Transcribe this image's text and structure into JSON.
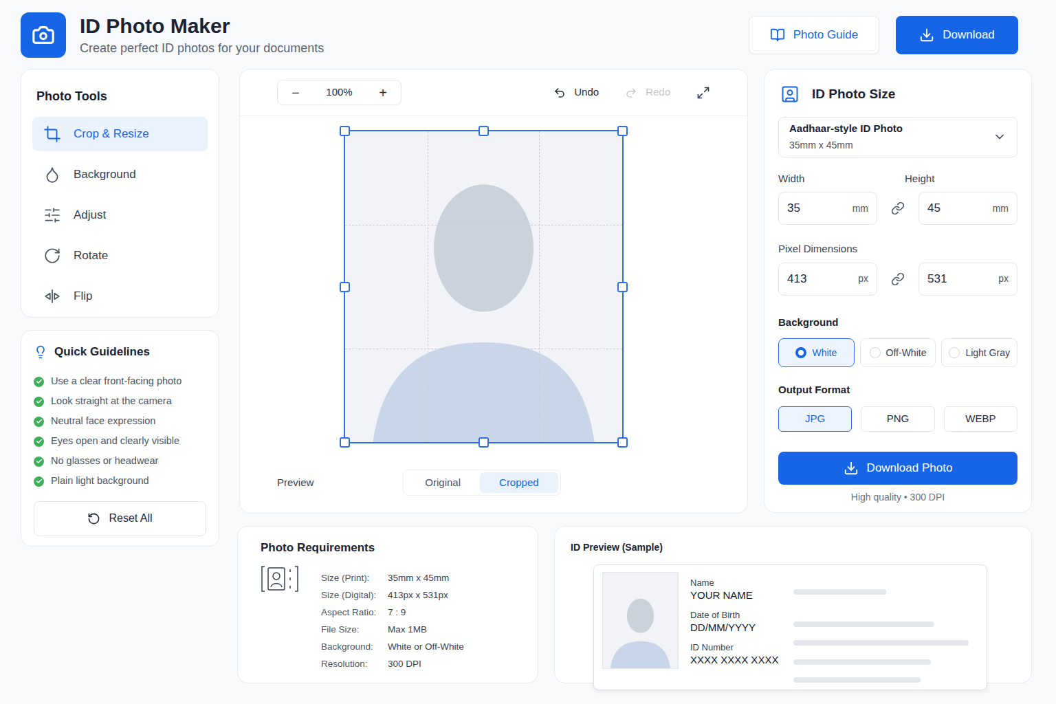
{
  "header": {
    "title": "ID Photo Maker",
    "subtitle": "Create perfect ID photos for your documents",
    "buttons": [
      {
        "label": "Photo Guide",
        "kind": "outline"
      },
      {
        "label": "Download",
        "kind": "primary"
      }
    ]
  },
  "tools": {
    "title": "Photo Tools",
    "items": [
      {
        "label": "Crop & Resize",
        "selected": true
      },
      {
        "label": "Background",
        "selected": false
      },
      {
        "label": "Adjust",
        "selected": false
      },
      {
        "label": "Rotate",
        "selected": false
      },
      {
        "label": "Flip",
        "selected": false
      }
    ]
  },
  "guidelines": {
    "title": "Quick Guidelines",
    "items": [
      {
        "label": "Use a clear front-facing photo",
        "checked": true
      },
      {
        "label": "Look straight at the camera",
        "checked": true
      },
      {
        "label": "Neutral face expression",
        "checked": true
      },
      {
        "label": "Eyes open and clearly visible",
        "checked": true
      },
      {
        "label": "No glasses or headwear",
        "checked": true
      },
      {
        "label": "Plain light background",
        "checked": true
      }
    ],
    "reset": "Reset All"
  },
  "editor": {
    "zoom_out": "−",
    "zoom": "100%",
    "zoom_in": "+",
    "undo": {
      "label": "Undo",
      "disabled": false
    },
    "redo": {
      "label": "Redo",
      "disabled": true
    },
    "preview": {
      "label": "Preview",
      "tabs": [
        {
          "label": "Original",
          "selected": false
        },
        {
          "label": "Cropped",
          "selected": true
        }
      ]
    }
  },
  "size_panel": {
    "title": "ID Photo Size",
    "preset": {
      "name": "Aadhaar-style ID Photo",
      "size": "35mm x 45mm"
    },
    "physical": {
      "width": {
        "label": "Width",
        "value": "35",
        "unit": "mm"
      },
      "height": {
        "label": "Height",
        "value": "45",
        "unit": "mm"
      },
      "linked": true
    },
    "pixels": {
      "label": "Pixel Dimensions",
      "width": {
        "value": "413",
        "unit": "px"
      },
      "height": {
        "value": "531",
        "unit": "px"
      },
      "linked": true
    },
    "background": {
      "label": "Background",
      "options": [
        {
          "label": "White",
          "selected": true
        },
        {
          "label": "Off-White",
          "selected": false
        },
        {
          "label": "Light Gray",
          "selected": false
        }
      ]
    },
    "format": {
      "label": "Output Format",
      "options": [
        {
          "label": "JPG",
          "selected": true
        },
        {
          "label": "PNG",
          "selected": false
        },
        {
          "label": "WEBP",
          "selected": false
        }
      ]
    },
    "download": {
      "label": "Download Photo",
      "note": "High quality • 300 DPI"
    }
  },
  "requirements": {
    "title": "Photo Requirements",
    "rows": [
      {
        "label": "Size (Print):",
        "value": "35mm x 45mm"
      },
      {
        "label": "Size (Digital):",
        "value": "413px x 531px"
      },
      {
        "label": "Aspect Ratio:",
        "value": "7 : 9"
      },
      {
        "label": "File Size:",
        "value": "Max 1MB"
      },
      {
        "label": "Background:",
        "value": "White or Off-White"
      },
      {
        "label": "Resolution:",
        "value": "300 DPI"
      }
    ]
  },
  "id_preview": {
    "title": "ID Preview (Sample)",
    "fields": [
      {
        "label": "Name",
        "value": "YOUR NAME"
      },
      {
        "label": "Date of Birth",
        "value": "DD/MM/YYYY"
      },
      {
        "label": "ID Number",
        "value": "XXXX XXXX XXXX"
      }
    ]
  }
}
